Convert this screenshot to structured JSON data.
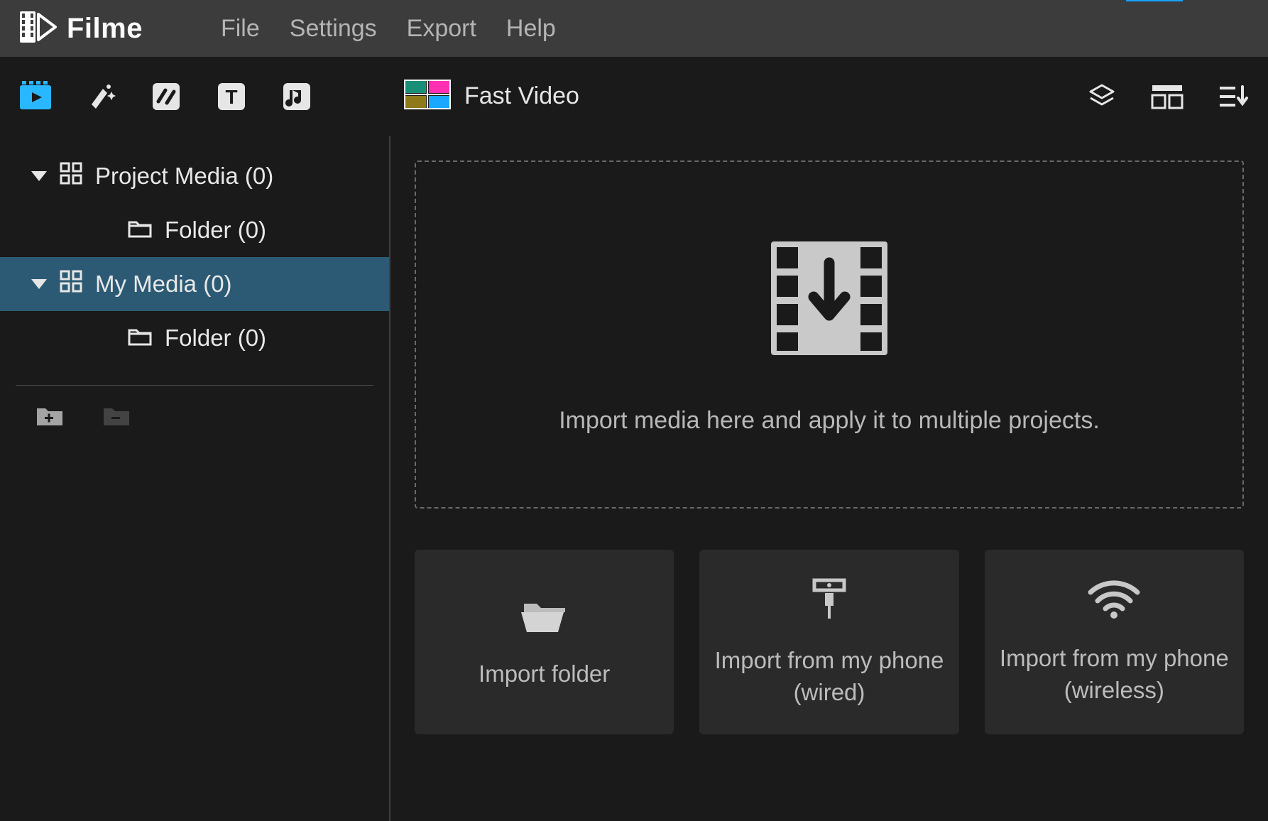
{
  "app": {
    "name": "Filme"
  },
  "menu": [
    "File",
    "Settings",
    "Export",
    "Help"
  ],
  "toolbar": {
    "fast_video": "Fast Video"
  },
  "sidebar": {
    "items": [
      {
        "label": "Project Media (0)",
        "type": "root"
      },
      {
        "label": "Folder (0)",
        "type": "child"
      },
      {
        "label": "My Media (0)",
        "type": "root",
        "selected": true
      },
      {
        "label": "Folder (0)",
        "type": "child"
      }
    ]
  },
  "dropzone": {
    "text": "Import media here and apply it to multiple projects."
  },
  "cards": [
    {
      "label": "Import folder"
    },
    {
      "label": "Import from my phone (wired)"
    },
    {
      "label": "Import from my phone (wireless)"
    }
  ]
}
